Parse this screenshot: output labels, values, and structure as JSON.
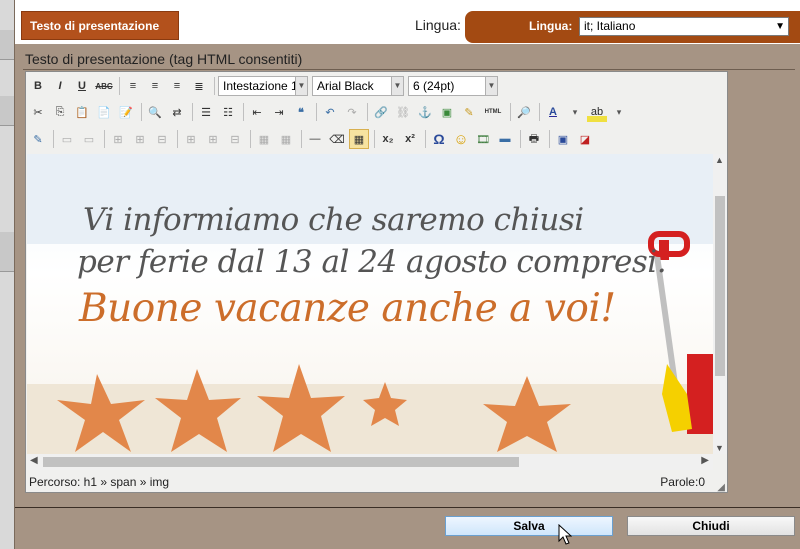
{
  "header": {
    "title": "Testo di presentazione",
    "lingua_label": "Lingua:",
    "lang_field_label": "Lingua:",
    "lang_value": "it; Italiano"
  },
  "section": {
    "title": "Testo di presentazione (tag HTML consentiti)"
  },
  "toolbar": {
    "format_value": "Intestazione 1",
    "font_value": "Arial Black",
    "size_value": "6 (24pt)",
    "bold": "B",
    "italic": "I",
    "underline": "U",
    "strike": "ABC",
    "html_label": "HTML",
    "subscript": "x₂",
    "superscript": "x²",
    "omega": "Ω"
  },
  "content": {
    "line1": "Vi informiamo che saremo chiusi",
    "line2": "per ferie dal 13 al 24 agosto compresi.",
    "line3": "Buone vacanze anche a voi!"
  },
  "status": {
    "path": "Percorso: h1 » span » img",
    "words": "Parole:0"
  },
  "buttons": {
    "save": "Salva",
    "close": "Chiudi"
  },
  "colors": {
    "accent": "#b3511c",
    "dialog_bg": "#a69484",
    "headline_orange": "#cc6d2a"
  }
}
